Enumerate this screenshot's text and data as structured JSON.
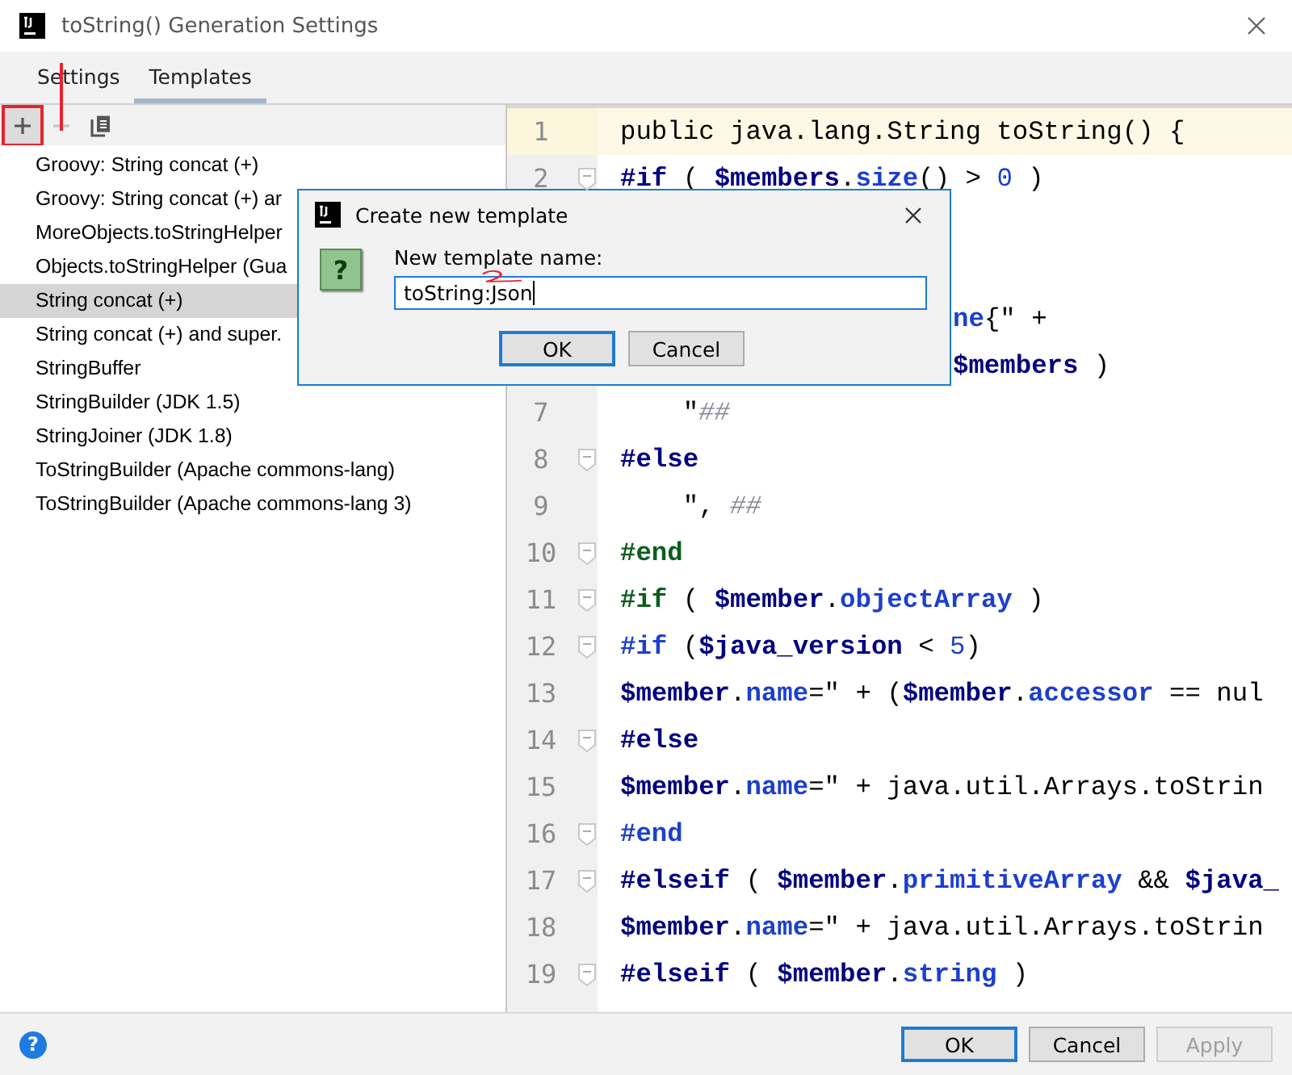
{
  "window": {
    "title": "toString() Generation Settings"
  },
  "tabs": [
    {
      "label": "Settings",
      "selected": false
    },
    {
      "label": "Templates",
      "selected": true
    }
  ],
  "toolbar": [
    {
      "kind": "add",
      "disabled": false,
      "marked": true
    },
    {
      "kind": "remove",
      "disabled": true,
      "marked": false
    },
    {
      "kind": "copy",
      "disabled": false,
      "marked": false
    }
  ],
  "templates": [
    {
      "label": "Groovy: String concat (+)",
      "selected": false
    },
    {
      "label": "Groovy: String concat (+) ar",
      "selected": false
    },
    {
      "label": "MoreObjects.toStringHelper",
      "selected": false
    },
    {
      "label": "Objects.toStringHelper (Gua",
      "selected": false
    },
    {
      "label": "String concat (+)",
      "selected": true
    },
    {
      "label": "String concat (+) and super.",
      "selected": false
    },
    {
      "label": "StringBuffer",
      "selected": false
    },
    {
      "label": "StringBuilder (JDK 1.5)",
      "selected": false
    },
    {
      "label": "StringJoiner (JDK 1.8)",
      "selected": false
    },
    {
      "label": "ToStringBuilder (Apache commons-lang)",
      "selected": false
    },
    {
      "label": "ToStringBuilder (Apache commons-lang 3)",
      "selected": false
    }
  ],
  "editor": {
    "lines": [
      {
        "kind": "line",
        "number": "1",
        "current": true,
        "fold": false,
        "tokens": [
          {
            "kind": "plain",
            "text": "public java.lang.String toString() {"
          }
        ]
      },
      {
        "kind": "line",
        "number": "2",
        "current": false,
        "fold": true,
        "tokens": [
          {
            "kind": "keyword",
            "color": "#000080",
            "text": "#if"
          },
          {
            "kind": "plain",
            "text": " ( "
          },
          {
            "kind": "var",
            "text": "$members"
          },
          {
            "kind": "plain",
            "text": "."
          },
          {
            "kind": "field",
            "text": "size"
          },
          {
            "kind": "plain",
            "text": "() > "
          },
          {
            "kind": "number",
            "text": "0"
          },
          {
            "kind": "plain",
            "text": " )"
          }
        ]
      },
      {
        "kind": "covered"
      },
      {
        "kind": "covered"
      },
      {
        "kind": "covered",
        "tokens": [
          {
            "kind": "field",
            "text": "ne"
          },
          {
            "kind": "plain",
            "text": "{\" +"
          }
        ]
      },
      {
        "kind": "covered",
        "tokens": [
          {
            "kind": "var",
            "text": "$members"
          },
          {
            "kind": "plain",
            "text": " )"
          }
        ]
      },
      {
        "kind": "line",
        "number": "7",
        "current": false,
        "fold": false,
        "tokens": [
          {
            "kind": "plain",
            "text": "    \""
          },
          {
            "kind": "comment",
            "text": "##"
          }
        ]
      },
      {
        "kind": "line",
        "number": "8",
        "current": false,
        "fold": true,
        "tokens": [
          {
            "kind": "keyword",
            "color": "#000080",
            "text": "#else"
          }
        ]
      },
      {
        "kind": "line",
        "number": "9",
        "current": false,
        "fold": false,
        "tokens": [
          {
            "kind": "plain",
            "text": "    \", "
          },
          {
            "kind": "comment",
            "text": "##"
          }
        ]
      },
      {
        "kind": "line",
        "number": "10",
        "current": false,
        "fold": true,
        "tokens": [
          {
            "kind": "keyword",
            "color": "#0b5e1c",
            "text": "#end"
          }
        ]
      },
      {
        "kind": "line",
        "number": "11",
        "current": false,
        "fold": true,
        "tokens": [
          {
            "kind": "keyword",
            "color": "#0b5e1c",
            "text": "#if"
          },
          {
            "kind": "plain",
            "text": " ( "
          },
          {
            "kind": "var",
            "text": "$member"
          },
          {
            "kind": "plain",
            "text": "."
          },
          {
            "kind": "field",
            "text": "objectArray"
          },
          {
            "kind": "plain",
            "text": " )"
          }
        ]
      },
      {
        "kind": "line",
        "number": "12",
        "current": false,
        "fold": true,
        "tokens": [
          {
            "kind": "keyword",
            "color": "#1c3fd0",
            "text": "#if"
          },
          {
            "kind": "plain",
            "text": " ("
          },
          {
            "kind": "var",
            "text": "$java_version"
          },
          {
            "kind": "plain",
            "text": " < "
          },
          {
            "kind": "number",
            "text": "5"
          },
          {
            "kind": "plain",
            "text": ")"
          }
        ]
      },
      {
        "kind": "line",
        "number": "13",
        "current": false,
        "fold": false,
        "tokens": [
          {
            "kind": "var",
            "text": "$member"
          },
          {
            "kind": "plain",
            "text": "."
          },
          {
            "kind": "field",
            "text": "name"
          },
          {
            "kind": "plain",
            "text": "=\" + ("
          },
          {
            "kind": "var",
            "text": "$member"
          },
          {
            "kind": "plain",
            "text": "."
          },
          {
            "kind": "field",
            "text": "accessor"
          },
          {
            "kind": "plain",
            "text": " == nul"
          }
        ]
      },
      {
        "kind": "line",
        "number": "14",
        "current": false,
        "fold": true,
        "tokens": [
          {
            "kind": "keyword",
            "color": "#000080",
            "text": "#else"
          }
        ]
      },
      {
        "kind": "line",
        "number": "15",
        "current": false,
        "fold": false,
        "tokens": [
          {
            "kind": "var",
            "text": "$member"
          },
          {
            "kind": "plain",
            "text": "."
          },
          {
            "kind": "field",
            "text": "name"
          },
          {
            "kind": "plain",
            "text": "=\" + java.util.Arrays.toStrin"
          }
        ]
      },
      {
        "kind": "line",
        "number": "16",
        "current": false,
        "fold": true,
        "tokens": [
          {
            "kind": "keyword",
            "color": "#1c3fd0",
            "text": "#end"
          }
        ]
      },
      {
        "kind": "line",
        "number": "17",
        "current": false,
        "fold": true,
        "tokens": [
          {
            "kind": "keyword",
            "color": "#000080",
            "text": "#elseif"
          },
          {
            "kind": "plain",
            "text": " ( "
          },
          {
            "kind": "var",
            "text": "$member"
          },
          {
            "kind": "plain",
            "text": "."
          },
          {
            "kind": "field",
            "text": "primitiveArray"
          },
          {
            "kind": "plain",
            "text": " && "
          },
          {
            "kind": "var",
            "text": "$java_"
          }
        ]
      },
      {
        "kind": "line",
        "number": "18",
        "current": false,
        "fold": false,
        "tokens": [
          {
            "kind": "var",
            "text": "$member"
          },
          {
            "kind": "plain",
            "text": "."
          },
          {
            "kind": "field",
            "text": "name"
          },
          {
            "kind": "plain",
            "text": "=\" + java.util.Arrays.toStrin"
          }
        ]
      },
      {
        "kind": "line",
        "number": "19",
        "current": false,
        "fold": true,
        "tokens": [
          {
            "kind": "keyword",
            "color": "#000080",
            "text": "#elseif"
          },
          {
            "kind": "plain",
            "text": " ( "
          },
          {
            "kind": "var",
            "text": "$member"
          },
          {
            "kind": "plain",
            "text": "."
          },
          {
            "kind": "field",
            "text": "string"
          },
          {
            "kind": "plain",
            "text": " )"
          }
        ]
      }
    ]
  },
  "footer": {
    "help": "?",
    "buttons": [
      {
        "label": "OK",
        "default": true,
        "disabled": false
      },
      {
        "label": "Cancel",
        "default": false,
        "disabled": false
      },
      {
        "label": "Apply",
        "default": false,
        "disabled": true
      }
    ]
  },
  "dialog": {
    "title": "Create new template",
    "question_icon": "?",
    "label": "New template name:",
    "value": "toString:Json",
    "buttons": [
      {
        "label": "OK",
        "default": true
      },
      {
        "label": "Cancel",
        "default": false
      }
    ]
  }
}
